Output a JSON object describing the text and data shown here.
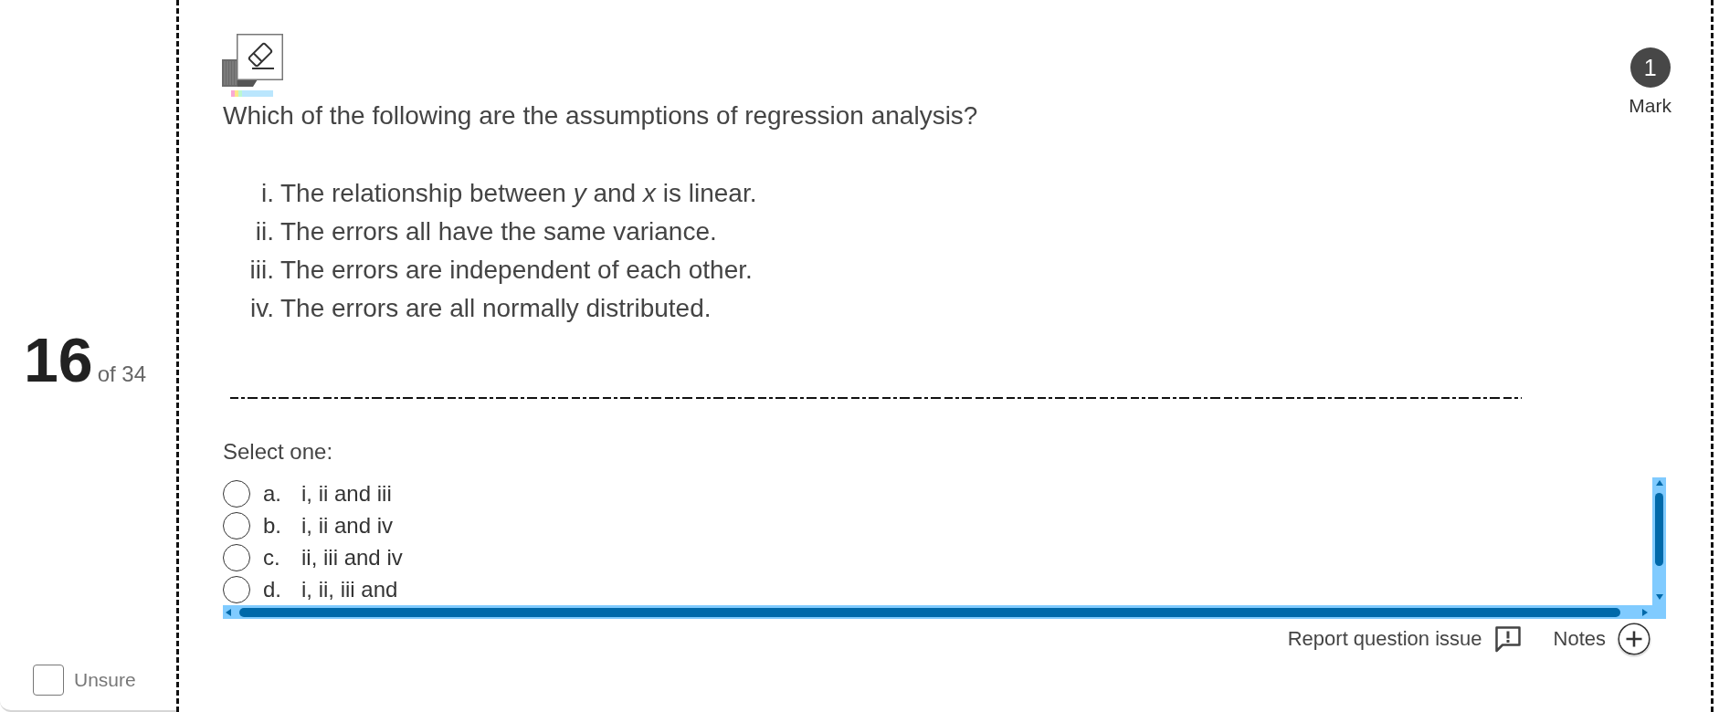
{
  "question_nav": {
    "number": "16",
    "total": "of 34",
    "unsure": {
      "label": "Unsure",
      "checked": false
    }
  },
  "question": {
    "mark": {
      "value": "1",
      "label": "Mark"
    },
    "text": "Which of the following are the assumptions of regression analysis?",
    "statements": [
      {
        "numeral": "i.",
        "text": "The relationship between *y* and *x* is linear."
      },
      {
        "numeral": "ii.",
        "text": "The errors all have the same variance."
      },
      {
        "numeral": "iii.",
        "text": "The errors are independent of each other."
      },
      {
        "numeral": "iv.",
        "text": "The errors are all normally distributed."
      }
    ],
    "prompt": "Select one:",
    "options": [
      {
        "letter": "a.",
        "text": "i, ii and iii",
        "selected": false
      },
      {
        "letter": "b.",
        "text": "i, ii and iv",
        "selected": false
      },
      {
        "letter": "c.",
        "text": "ii, iii and iv",
        "selected": false
      },
      {
        "letter": "d.",
        "text": "i, ii, iii and",
        "selected": false
      }
    ]
  },
  "actions": [
    {
      "kind": "report",
      "label": "Report question issue"
    },
    {
      "kind": "notes",
      "label": "Notes"
    }
  ]
}
